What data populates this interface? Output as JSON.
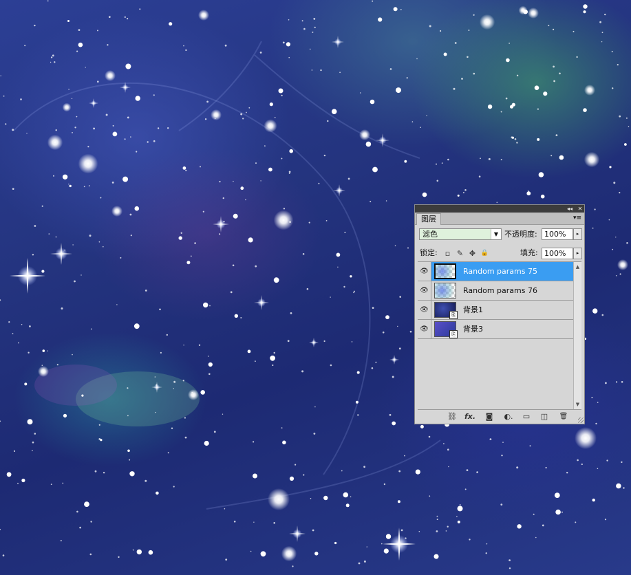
{
  "canvas": {
    "description_icon": "starfield-nebula",
    "colors": {
      "deep": "#1d2a73",
      "mid": "#2c3f95",
      "green_glow": "#3c8c6e",
      "star": "#ffffff"
    }
  },
  "layers_panel": {
    "titlebar": {
      "collapse_icon": "double-chevron-icon",
      "collapse_glyph": "◂◂",
      "close_glyph": "✕"
    },
    "tab_label": "图层",
    "menu_glyph": "▾≡",
    "blend_mode": "滤色",
    "blend_arrow_glyph": "▼",
    "opacity_label": "不透明度:",
    "opacity_value": "100%",
    "lock_label": "锁定:",
    "lock_glyphs": [
      "▫",
      "✎",
      "✥",
      "🔒"
    ],
    "fill_label": "填充:",
    "fill_value": "100%",
    "stepper_glyph": "▸",
    "eye_glyph": "👁",
    "layers": [
      {
        "name": "Random params 75",
        "selected": true,
        "thumb": "checker-nebula"
      },
      {
        "name": "Random params 76",
        "selected": false,
        "thumb": "checker-nebula"
      },
      {
        "name": "背景1",
        "selected": false,
        "thumb": "space-linked"
      },
      {
        "name": "背景3",
        "selected": false,
        "thumb": "space-linked"
      }
    ],
    "link_glyph": "⎘",
    "scroll_up_glyph": "▲",
    "scroll_down_glyph": "▼",
    "bottom_icons": [
      {
        "name": "link-layers-icon",
        "glyph": "⛓"
      },
      {
        "name": "fx-icon",
        "glyph": "fx."
      },
      {
        "name": "add-mask-icon",
        "glyph": "◙"
      },
      {
        "name": "adjustment-layer-icon",
        "glyph": "◐."
      },
      {
        "name": "new-group-icon",
        "glyph": "▭"
      },
      {
        "name": "new-layer-icon",
        "glyph": "◫"
      },
      {
        "name": "trash-icon",
        "glyph": "🗑"
      }
    ]
  }
}
